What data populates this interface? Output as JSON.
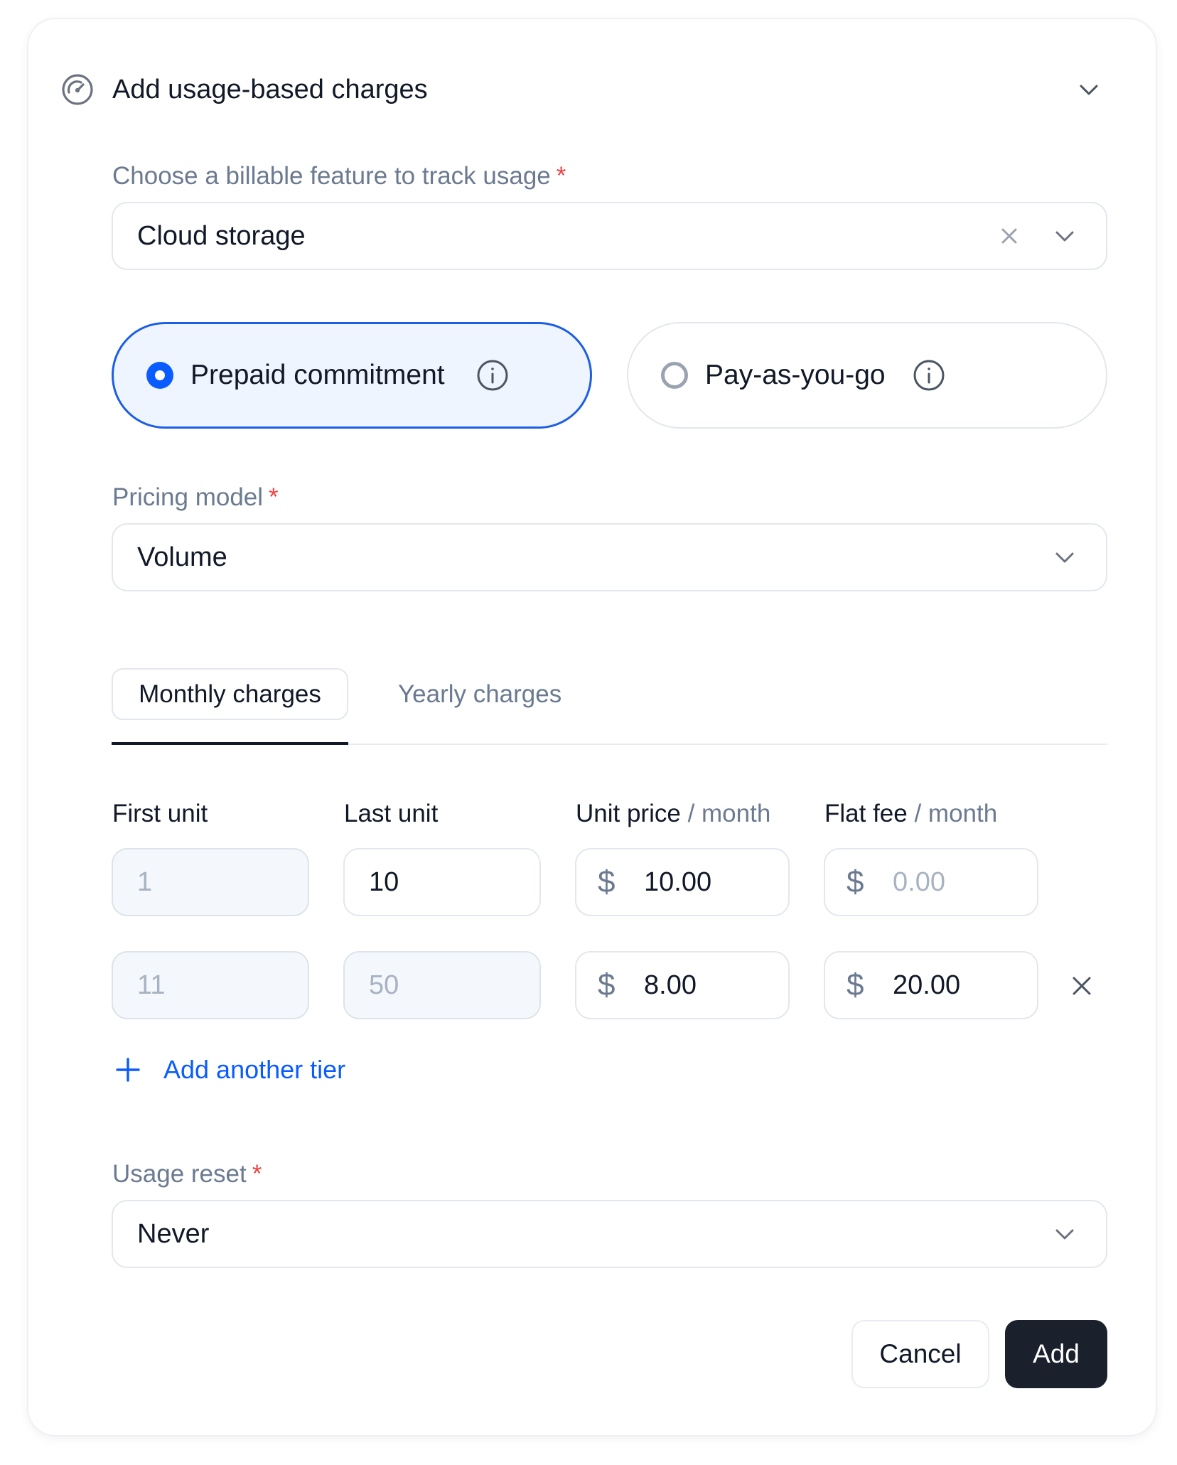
{
  "header": {
    "title": "Add usage-based charges",
    "icon": "speedometer-icon"
  },
  "feature": {
    "label": "Choose a billable feature to track usage",
    "required_mark": "*",
    "value": "Cloud storage"
  },
  "commitment": {
    "options": [
      {
        "label": "Prepaid commitment",
        "selected": true
      },
      {
        "label": "Pay-as-you-go",
        "selected": false
      }
    ]
  },
  "pricing_model": {
    "label": "Pricing model",
    "required_mark": "*",
    "value": "Volume"
  },
  "tabs": [
    {
      "label": "Monthly charges",
      "active": true
    },
    {
      "label": "Yearly charges",
      "active": false
    }
  ],
  "tiers": {
    "headers": {
      "first_unit": "First unit",
      "last_unit": "Last unit",
      "unit_price": "Unit price",
      "unit_price_suffix": "/ month",
      "flat_fee": "Flat fee",
      "flat_fee_suffix": "/ month"
    },
    "currency": "$",
    "rows": [
      {
        "first_unit": "1",
        "last_unit": "10",
        "unit_price": "10.00",
        "flat_fee": "",
        "flat_fee_placeholder": "0.00"
      },
      {
        "first_unit": "11",
        "last_unit": "50",
        "unit_price": "8.00",
        "flat_fee": "20.00"
      }
    ],
    "add_tier_label": "Add another tier"
  },
  "usage_reset": {
    "label": "Usage reset",
    "required_mark": "*",
    "value": "Never"
  },
  "actions": {
    "cancel": "Cancel",
    "add": "Add"
  },
  "colors": {
    "accent": "#0b5cff",
    "required": "#ef4444",
    "primary_button": "#1a202c"
  }
}
